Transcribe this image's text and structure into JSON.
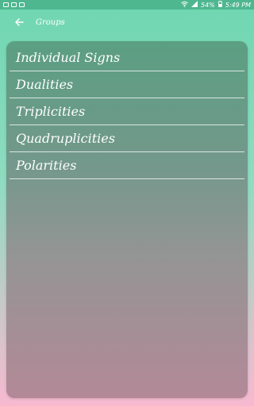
{
  "status_bar": {
    "battery": "54%",
    "time": "5:49 PM"
  },
  "app_bar": {
    "title": "Groups"
  },
  "groups": {
    "items": [
      {
        "label": "Individual Signs"
      },
      {
        "label": "Dualities"
      },
      {
        "label": "Triplicities"
      },
      {
        "label": "Quadruplicities"
      },
      {
        "label": "Polarities"
      }
    ]
  }
}
